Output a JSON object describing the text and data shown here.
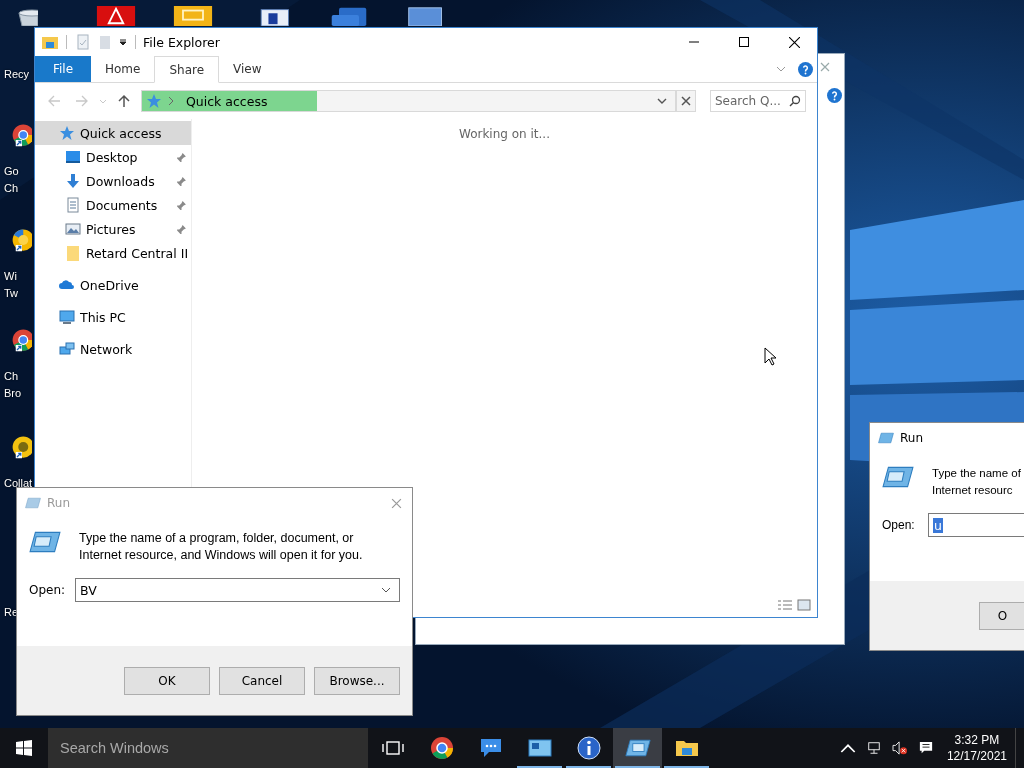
{
  "desktop": {
    "icons": [
      {
        "kind": "recycle-bin",
        "label_lines": [
          "Recy"
        ]
      },
      {
        "kind": "chrome",
        "label_lines": [
          "Go",
          "Ch"
        ]
      },
      {
        "kind": "swirl",
        "label_lines": [
          "Wi",
          "Tw"
        ]
      },
      {
        "kind": "chrome",
        "label_lines": [
          "Ch",
          "Bro"
        ]
      },
      {
        "kind": "disc",
        "label_lines": [
          "Collat"
        ]
      },
      {
        "label_lines": [
          "Re"
        ]
      }
    ],
    "top_icons": [
      {
        "kind": "red-app"
      },
      {
        "kind": "yellow-app"
      },
      {
        "kind": "computer"
      },
      {
        "kind": "blue-stack"
      },
      {
        "kind": "blue-window"
      }
    ]
  },
  "explorer": {
    "title": "File Explorer",
    "ribbon_tabs": [
      {
        "label": "File",
        "kind": "file"
      },
      {
        "label": "Home",
        "kind": "tab",
        "selected": false
      },
      {
        "label": "Share",
        "kind": "tab",
        "selected": true
      },
      {
        "label": "View",
        "kind": "tab",
        "selected": false
      }
    ],
    "address": "Quick access",
    "search": {
      "placeholder": "Search Q..."
    },
    "nav": [
      {
        "label": "Quick access",
        "kind": "star",
        "selected": true,
        "children": [
          {
            "label": "Desktop",
            "kind": "desktop",
            "pinned": true,
            "selected": false
          },
          {
            "label": "Downloads",
            "kind": "downloads",
            "pinned": true,
            "selected": false
          },
          {
            "label": "Documents",
            "kind": "documents",
            "pinned": true,
            "selected": false
          },
          {
            "label": "Pictures",
            "kind": "pictures",
            "pinned": true,
            "selected": false
          },
          {
            "label": "Retard Central II",
            "kind": "folder",
            "pinned": false,
            "selected": false
          }
        ]
      },
      {
        "label": "OneDrive",
        "kind": "cloud",
        "selected": false
      },
      {
        "label": "This PC",
        "kind": "pc",
        "selected": false
      },
      {
        "label": "Network",
        "kind": "network",
        "selected": false
      }
    ],
    "status": "Working on it..."
  },
  "run_dialog_right": {
    "title": "Run",
    "message_lines": [
      "Type the name of",
      "Internet resourc"
    ],
    "open_label": "Open:",
    "value": "u",
    "text_selected": true,
    "buttons": [
      "O"
    ]
  },
  "run_dialog": {
    "title": "Run",
    "message": "Type the name of a program, folder, document, or Internet resource, and Windows will open it for you.",
    "open_label": "Open:",
    "value": "BV",
    "buttons": [
      "OK",
      "Cancel",
      "Browse..."
    ]
  },
  "taskbar": {
    "search": {
      "placeholder": "Search Windows"
    },
    "apps": [
      {
        "kind": "task-view",
        "running": false,
        "active": false
      },
      {
        "kind": "chrome",
        "running": false,
        "active": false
      },
      {
        "kind": "chat",
        "running": false,
        "active": false
      },
      {
        "kind": "app",
        "running": true,
        "active": false
      },
      {
        "kind": "info",
        "running": true,
        "active": false
      },
      {
        "kind": "run",
        "running": true,
        "active": true
      },
      {
        "kind": "folder",
        "running": true,
        "active": false
      }
    ],
    "time": "3:32 PM",
    "date": "12/17/2021"
  }
}
